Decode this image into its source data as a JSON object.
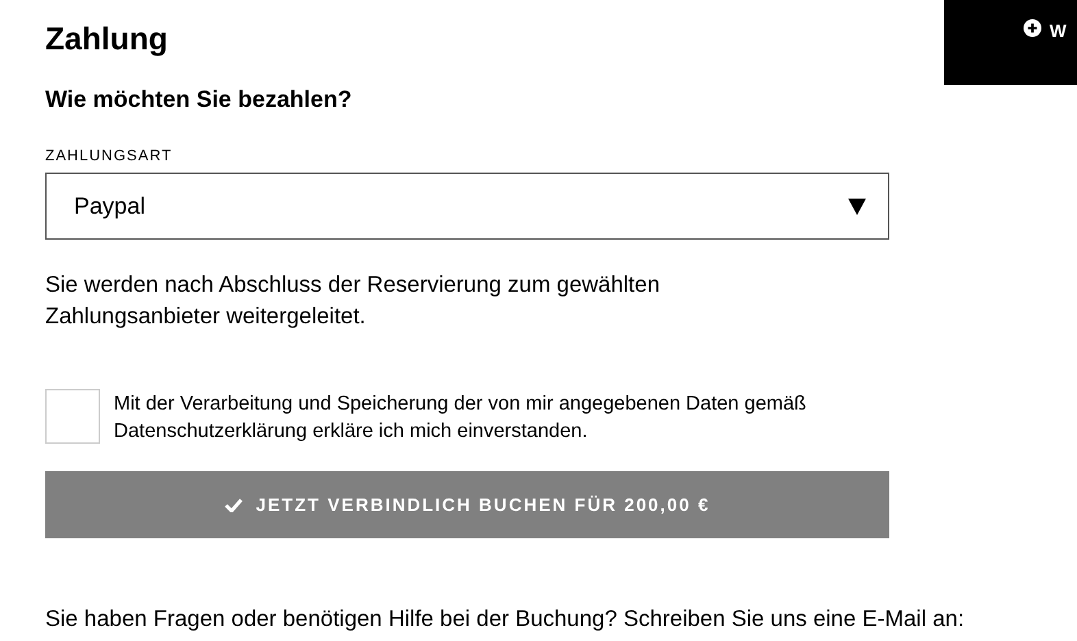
{
  "heading": "Zahlung",
  "question": "Wie möchten Sie bezahlen?",
  "payment_select": {
    "label": "ZAHLUNGSART",
    "value": "Paypal"
  },
  "redirect_note": "Sie werden nach Abschluss der Reservierung zum gewählten Zahlungsanbieter weitergeleitet.",
  "consent": {
    "checked": false,
    "text": "Mit der Verarbeitung und Speicherung der von mir angegebenen Daten gemäß Datenschutzerklärung erkläre ich mich einverstanden."
  },
  "book_button": "JETZT VERBINDLICH BUCHEN FÜR 200,00 €",
  "help_text": "Sie haben Fragen oder benötigen Hilfe bei der Buchung? Schreiben Sie uns eine E-Mail an:",
  "corner_button": "W"
}
